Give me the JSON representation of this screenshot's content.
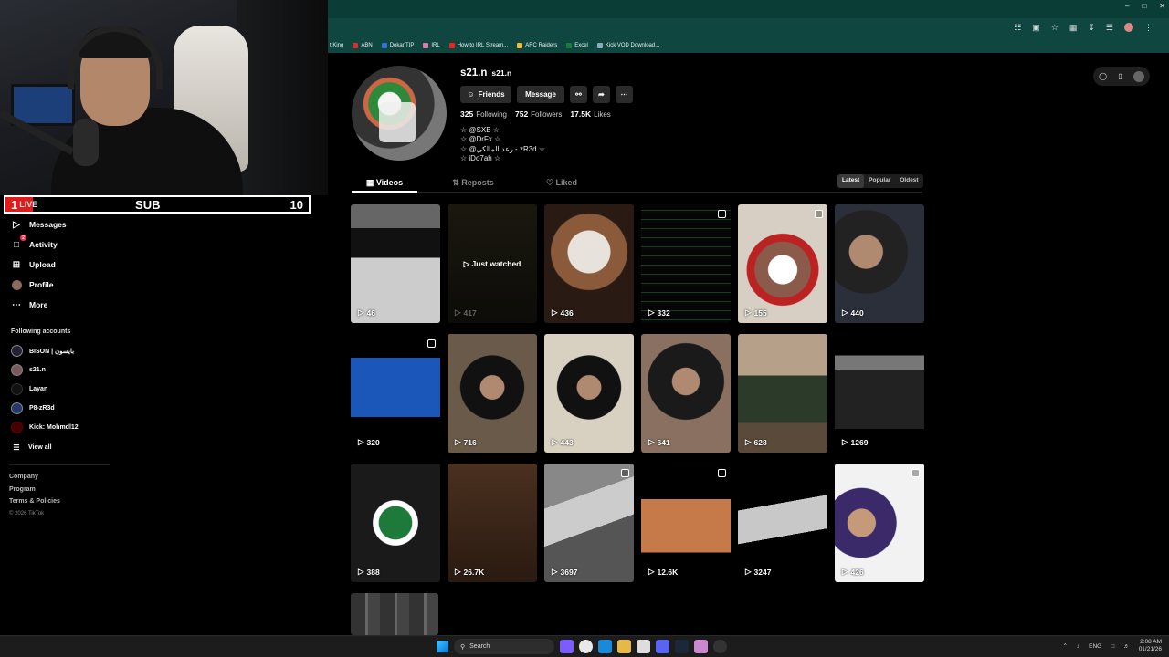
{
  "overlay": {
    "sub_count": "1",
    "live_label": "LIVE",
    "sub_label": "SUB",
    "sub_goal": "10"
  },
  "sidebar": {
    "nav": [
      {
        "label": "Messages",
        "icon": "send-icon"
      },
      {
        "label": "Activity",
        "icon": "activity-icon",
        "badge": "2"
      },
      {
        "label": "Upload",
        "icon": "upload-icon"
      },
      {
        "label": "Profile",
        "icon": "profile-icon"
      },
      {
        "label": "More",
        "icon": "more-icon"
      }
    ],
    "following_title": "Following accounts",
    "accounts": [
      "BISON | بايسون",
      "s21.n",
      "Layan",
      "P8-zR3d",
      "Kick: Mohmdl12"
    ],
    "view_all": "View all",
    "footer": [
      "Company",
      "Program",
      "Terms & Policies"
    ],
    "copyright": "© 2026 TikTok"
  },
  "bookmarks": [
    "t King",
    "ABN",
    "DokanTIP",
    "IRL",
    "How to IRL Stream...",
    "ARC Raiders",
    "Excel",
    "Kick VOD Download..."
  ],
  "profile": {
    "username": "s21.n",
    "nickname": "s21.n",
    "buttons": {
      "friends": "Friends",
      "message": "Message"
    },
    "stats": {
      "following_count": "325",
      "following_label": "Following",
      "followers_count": "752",
      "followers_label": "Followers",
      "likes_count": "17.5K",
      "likes_label": "Likes"
    },
    "bio": [
      "☆ @SXB ☆",
      "☆ @DrFx ☆",
      "☆ @رعد المالكي - zR3d ☆",
      "☆ iDo7ah ☆"
    ]
  },
  "tabs": [
    "Videos",
    "Reposts",
    "Liked"
  ],
  "sort": [
    "Latest",
    "Popular",
    "Oldest"
  ],
  "videos": [
    "46",
    "417",
    "436",
    "332",
    "155",
    "440",
    "320",
    "716",
    "443",
    "641",
    "628",
    "1269",
    "388",
    "26.7K",
    "3697",
    "12.6K",
    "3247",
    "426"
  ],
  "just_watched": "Just watched",
  "taskbar": {
    "search": "Search",
    "lang": "ENG",
    "time": "2:08 AM",
    "date": "01/21/26"
  }
}
